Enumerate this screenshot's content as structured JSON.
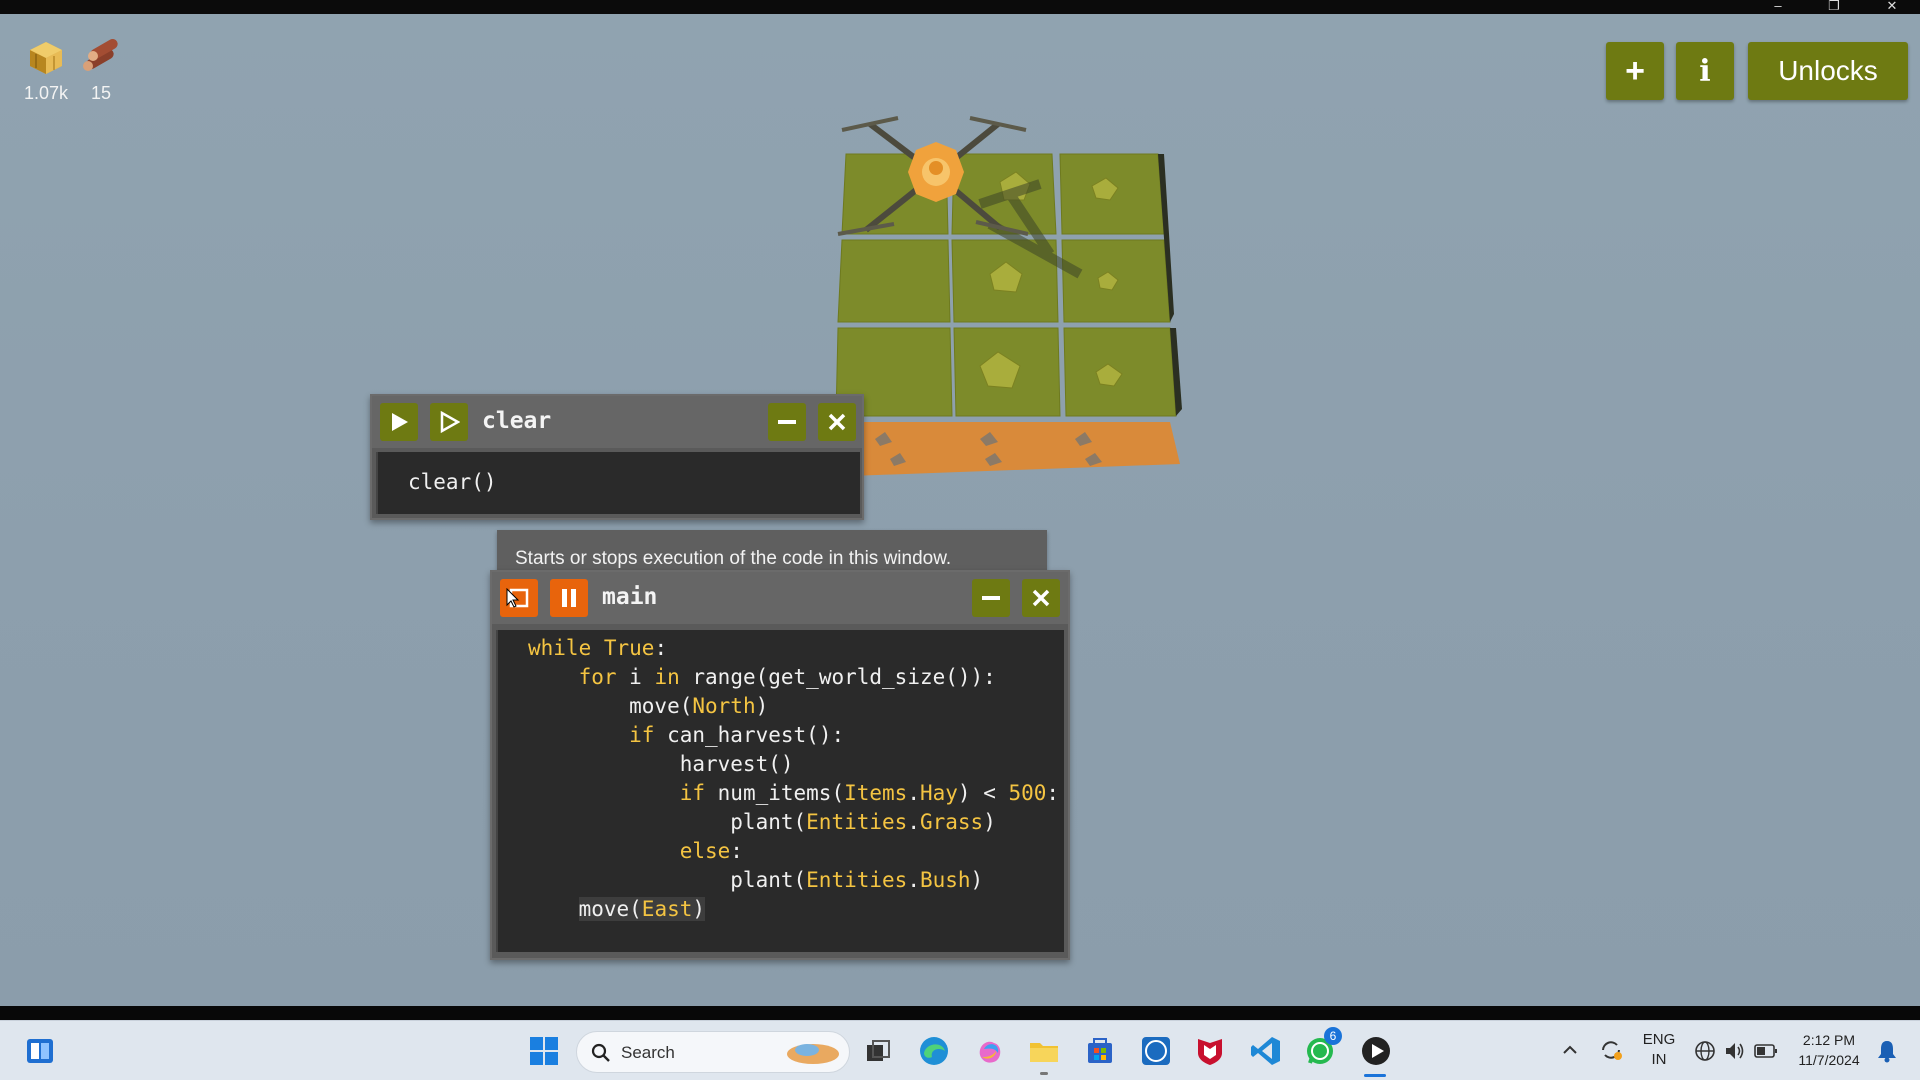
{
  "window": {
    "minimize_glyph": "–",
    "restore_glyph": "❐",
    "close_glyph": "✕"
  },
  "resources": [
    {
      "name": "hay-icon",
      "value": "1.07k"
    },
    {
      "name": "wood-icon",
      "value": "15"
    }
  ],
  "top_buttons": {
    "add_label": "+",
    "info_label": "i",
    "unlocks_label": "Unlocks"
  },
  "clear_window": {
    "title": "clear",
    "code": [
      "clear()"
    ]
  },
  "tooltip": "Starts or stops execution of the code in this window.",
  "main_window": {
    "title": "main",
    "code": [
      "while True:",
      "    for i in range(get_world_size()):",
      "        move(North)",
      "        if can_harvest():",
      "            harvest()",
      "            if num_items(Items.Hay) < 500:",
      "                plant(Entities.Grass)",
      "            else:",
      "                plant(Entities.Bush)",
      "    move(East)"
    ]
  },
  "colors": {
    "button_green": "#6e7a12",
    "button_orange": "#e8640c",
    "keyword_yellow": "#f4c442",
    "sky": "#8d9fad"
  },
  "taskbar": {
    "search_placeholder": "Search",
    "whatsapp_badge": "6",
    "language_line1": "ENG",
    "language_line2": "IN",
    "time": "2:12 PM",
    "date": "11/7/2024"
  }
}
